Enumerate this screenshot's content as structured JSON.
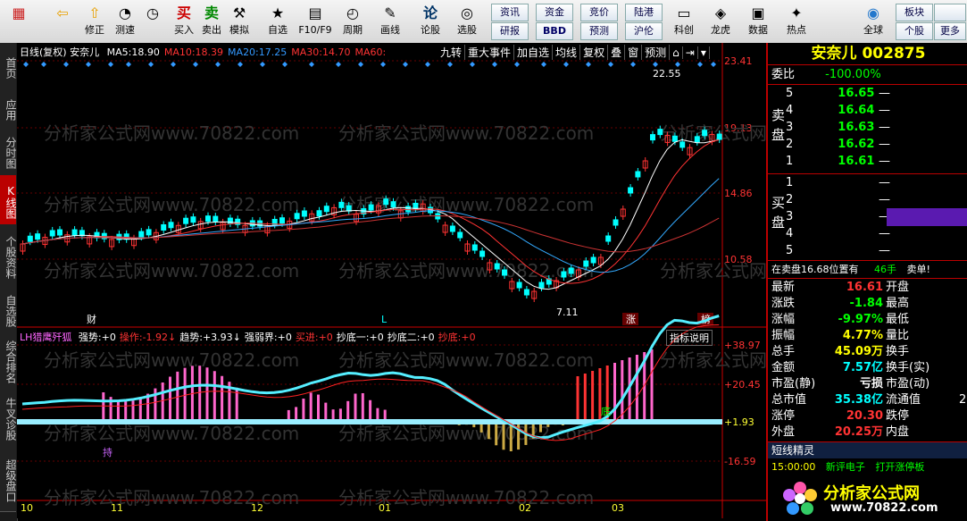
{
  "toolbar": {
    "buttons": [
      {
        "label": "",
        "icon": "grid-icon"
      },
      {
        "label": "",
        "icon": "back-arrow-icon"
      },
      {
        "label": "修正",
        "icon": "up-arrow-icon"
      },
      {
        "label": "测速",
        "icon": "speedometer-icon"
      },
      {
        "label": "",
        "icon": "clock-icon"
      },
      {
        "label": "买入",
        "icon": "buy-icon",
        "glyph": "买"
      },
      {
        "label": "卖出",
        "icon": "sell-icon",
        "glyph": "卖"
      },
      {
        "label": "模拟",
        "icon": "hammer-icon"
      },
      {
        "label": "自选",
        "icon": "star-icon"
      },
      {
        "label": "F10/F9",
        "icon": "f10-icon"
      },
      {
        "label": "周期",
        "icon": "period-icon"
      },
      {
        "label": "画线",
        "icon": "pencil-icon"
      },
      {
        "label": "论股",
        "icon": "chat-icon",
        "glyph": "论"
      },
      {
        "label": "选股",
        "icon": "stock-select-icon"
      },
      {
        "label": "科创",
        "icon": "kechuang-icon"
      },
      {
        "label": "龙虎",
        "icon": "dragon-icon"
      },
      {
        "label": "数据",
        "icon": "pe-icon"
      },
      {
        "label": "热点",
        "icon": "hot-icon"
      },
      {
        "label": "",
        "icon": "blank-icon"
      },
      {
        "label": "全球",
        "icon": "globe-icon"
      }
    ],
    "small_buttons": [
      "资讯",
      "资金",
      "竞价",
      "陆港",
      "研报",
      "BBD",
      "预测",
      "沪伦",
      "板块",
      "",
      "个股",
      "更多"
    ]
  },
  "left_tabs": [
    "首页",
    "应用",
    "分时图",
    "K线图",
    "个股资料",
    "自选股",
    "综合排名",
    "牛叉诊股",
    "超级盘口"
  ],
  "chart": {
    "info_prefix": "日线(复权)",
    "stock_name": "安奈儿",
    "ma": [
      {
        "label": "MA5:",
        "value": "18.90",
        "color": "#ffffff"
      },
      {
        "label": "MA10:",
        "value": "18.39",
        "color": "#ff3333"
      },
      {
        "label": "MA20:",
        "value": "17.25",
        "color": "#3399ff"
      },
      {
        "label": "MA30:",
        "value": "14.70",
        "color": "#ff3333"
      },
      {
        "label": "MA60:",
        "value": "",
        "color": "#ff3333"
      }
    ],
    "buttons": [
      "九转",
      "重大事件",
      "加自选",
      "均线",
      "复权",
      "叠",
      "窗",
      "预测"
    ],
    "price_axis": [
      "23.41",
      "19.13",
      "14.86",
      "10.58"
    ],
    "high_label": "22.55",
    "low_label": "7.11",
    "markers": [
      "财",
      "L",
      "涨",
      "榜"
    ],
    "month_labels": [
      "10",
      "11",
      "12",
      "01",
      "02",
      "03"
    ],
    "watermark": "分析家公式网www.70822.com"
  },
  "indicator": {
    "name": "LH猎鹰歼狐",
    "items": [
      {
        "label": "强势:",
        "value": "+0",
        "color": "#ffffff"
      },
      {
        "label": "操作:",
        "value": "-1.92↓",
        "color": "#ff3333"
      },
      {
        "label": "趋势:",
        "value": "+3.93↓",
        "color": "#ffffff"
      },
      {
        "label": "强弱界:",
        "value": "+0",
        "color": "#ffffff"
      },
      {
        "label": "买进:",
        "value": "+0",
        "color": "#ff3333"
      },
      {
        "label": "抄底一:",
        "value": "+0",
        "color": "#ffffff"
      },
      {
        "label": "抄底二:",
        "value": "+0",
        "color": "#ffffff"
      },
      {
        "label": "抄底:",
        "value": "+0",
        "color": "#ff3333"
      }
    ],
    "help": "指标说明",
    "axis": [
      "+38.97",
      "+20.45",
      "+1.93",
      "-16.59"
    ],
    "labels": [
      "持",
      "底"
    ]
  },
  "quote": {
    "title": "安奈儿 002875",
    "weibi_label": "委比",
    "weibi_value": "-100.00%",
    "sell_label": "卖盘",
    "sell": [
      {
        "level": "5",
        "price": "16.65"
      },
      {
        "level": "4",
        "price": "16.64"
      },
      {
        "level": "3",
        "price": "16.63"
      },
      {
        "level": "2",
        "price": "16.62"
      },
      {
        "level": "1",
        "price": "16.61"
      }
    ],
    "buy_label": "买盘",
    "buy": [
      {
        "level": "1",
        "price": ""
      },
      {
        "level": "2",
        "price": ""
      },
      {
        "level": "3",
        "price": ""
      },
      {
        "level": "4",
        "price": ""
      },
      {
        "level": "5",
        "price": ""
      }
    ],
    "status": "在卖盘16.68位置有",
    "status_vol": "46手",
    "status_tail": "卖单!",
    "fields": [
      {
        "l": "最新",
        "v": "16.61",
        "c": "#ff3333",
        "l2": "开盘",
        "v2": ""
      },
      {
        "l": "涨跌",
        "v": "-1.84",
        "c": "#00ff00",
        "l2": "最高",
        "v2": ""
      },
      {
        "l": "涨幅",
        "v": "-9.97%",
        "c": "#00ff00",
        "l2": "最低",
        "v2": ""
      },
      {
        "l": "振幅",
        "v": "4.77%",
        "c": "#ffff00",
        "l2": "量比",
        "v2": ""
      },
      {
        "l": "总手",
        "v": "45.09万",
        "c": "#ffff00",
        "l2": "换手",
        "v2": ""
      },
      {
        "l": "金额",
        "v": "7.57亿",
        "c": "#00ffff",
        "l2": "换手(实)",
        "v2": ""
      },
      {
        "l": "市盈(静)",
        "v": "亏损",
        "c": "#ffffff",
        "l2": "市盈(动)",
        "v2": ""
      },
      {
        "l": "总市值",
        "v": "35.38亿",
        "c": "#00ffff",
        "l2": "流通值",
        "v2": "2"
      },
      {
        "l": "涨停",
        "v": "20.30",
        "c": "#ff3333",
        "l2": "跌停",
        "v2": ""
      },
      {
        "l": "外盘",
        "v": "20.25万",
        "c": "#ff3333",
        "l2": "内盘",
        "v2": ""
      }
    ],
    "sprite_title": "短线精灵",
    "sprite_row": {
      "time": "15:00:00",
      "name": "新评电子",
      "event": "打开涨停板"
    },
    "logo_text": "分析家公式网",
    "logo_url": "www.70822.com"
  }
}
